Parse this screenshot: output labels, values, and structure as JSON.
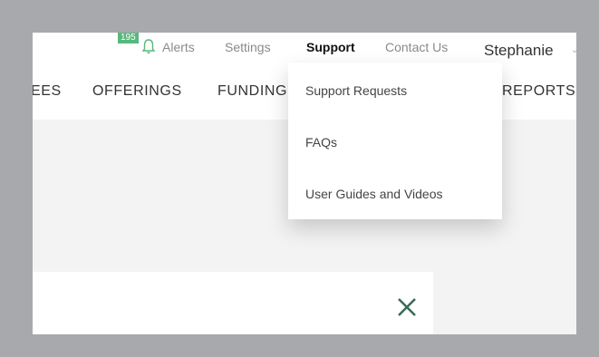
{
  "topbar": {
    "alerts_count": "195",
    "alerts_label": "Alerts",
    "settings_label": "Settings",
    "support_label": "Support",
    "contact_label": "Contact Us",
    "user_name": "Stephanie"
  },
  "nav": {
    "items": [
      {
        "label": "EES"
      },
      {
        "label": "OFFERINGS"
      },
      {
        "label": "FUNDING"
      },
      {
        "label": "REPORTS"
      }
    ]
  },
  "support_menu": {
    "items": [
      {
        "label": "Support Requests"
      },
      {
        "label": "FAQs"
      },
      {
        "label": "User Guides and Videos"
      }
    ]
  },
  "colors": {
    "accent_green": "#57b87c",
    "close_green": "#3d6b54",
    "frame_gray": "#a7a9ac"
  },
  "icons": [
    "bell-icon",
    "close-icon",
    "chevron-down-icon"
  ]
}
